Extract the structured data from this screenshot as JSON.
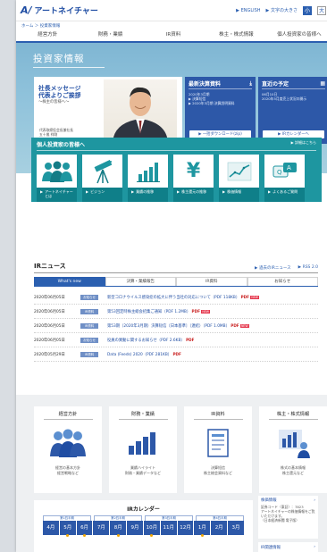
{
  "header": {
    "logo": "アートネイチャー",
    "english": "ENGLISH",
    "fontsize_label": "文字の大きさ",
    "fs_small": "小",
    "fs_large": "大"
  },
  "breadcrumb": "ホーム ＞ 投資家情報",
  "gnav": [
    "経営方針",
    "財務・業績",
    "IR資料",
    "株主・株式情報",
    "個人投資家の皆様へ"
  ],
  "hero": {
    "title": "投資家情報",
    "message_title_1": "社長メッセージ",
    "message_title_2": "代表よりご挨拶",
    "message_sub": "～株主の皆様へ～",
    "message_name_1": "代表取締役会長兼社長",
    "message_name_2": "五十嵐 祥剛",
    "latest_title": "最新決算資料",
    "latest_l1": "2020年3月期",
    "latest_l2": "▶ 決算短信",
    "latest_l3": "▶ 2020年3月期 決算説明資料",
    "latest_btn": "一括ダウンロード(zip)",
    "schedule_title": "直近の予定",
    "schedule_l1": "06月10日",
    "schedule_l2": "2020年5月度売上状況の開示",
    "schedule_btn": "IRカレンダーへ"
  },
  "individual": {
    "title": "個人投資家の皆様へ",
    "more": "▶ 詳細はこちら",
    "tiles": [
      {
        "label": "アートネイチャーとは",
        "icon": "people-icon"
      },
      {
        "label": "ビジョン",
        "icon": "telescope-icon"
      },
      {
        "label": "業績の推移",
        "icon": "bar-chart-icon"
      },
      {
        "label": "株主還元の推移",
        "icon": "yen-icon"
      },
      {
        "label": "株価情報",
        "icon": "line-chart-icon"
      },
      {
        "label": "よくあるご質問",
        "icon": "qa-icon"
      }
    ]
  },
  "ir": {
    "title": "IRニュース",
    "link_list": "▶ 過去のIRニュース",
    "link_rss": "▶ RSS 2.0",
    "tabs": [
      "What's new",
      "決算・業績報告",
      "IR資料",
      "お知らせ"
    ],
    "rows": [
      {
        "date": "2020年06月05日",
        "cat": "お知らせ",
        "text": "新型コロナウイルス感染症の拡大に伴う当社の対応について（PDF 118KB）",
        "pdf": "PDF",
        "new": "NEW"
      },
      {
        "date": "2020年06月05日",
        "cat": "IR資料",
        "text": "第53回定時株主総会招集ご通知（PDF 1.2MB）",
        "pdf": "PDF",
        "new": "NEW"
      },
      {
        "date": "2020年06月05日",
        "cat": "IR資料",
        "text": "第53期（2020年3月期）決算短信〔日本基準〕（連結）（PDF 1.0MB）",
        "pdf": "PDF",
        "new": "NEW"
      },
      {
        "date": "2020年06月05日",
        "cat": "お知らせ",
        "text": "役員の異動に関するお知らせ（PDF 2.6KB）",
        "pdf": "PDF",
        "new": ""
      },
      {
        "date": "2020年05月29日",
        "cat": "IR資料",
        "text": "Data (Feeds) 2020（PDF 281KB）",
        "pdf": "PDF",
        "new": ""
      }
    ]
  },
  "links": [
    {
      "title": "経営方針",
      "desc1": "経営の基本方針",
      "desc2": "経営戦略など"
    },
    {
      "title": "財務・業績",
      "desc1": "業績ハイライト",
      "desc2": "財務・業績データなど"
    },
    {
      "title": "IR資料",
      "desc1": "決算短信",
      "desc2": "株主総会資料など"
    },
    {
      "title": "株主・株式情報",
      "desc1": "株式の基本情報",
      "desc2": "株主還元など"
    }
  ],
  "calendar": {
    "title": "IRカレンダー",
    "quarters": [
      "第1四半期",
      "第2四半期",
      "第3四半期",
      "第4四半期"
    ],
    "months": [
      "4月",
      "5月",
      "6月",
      "7月",
      "8月",
      "9月",
      "10月",
      "11月",
      "12月",
      "1月",
      "2月",
      "3月"
    ]
  },
  "side": {
    "stock_title": "株価情報",
    "stock_l1": "証券コード（東証）：7823",
    "stock_l2": "アートネイチャーの株価情報をご覧いただけます。",
    "stock_l3": "（日本経済新聞 電子版）",
    "disclaimer": "IR関連情報"
  },
  "colors": {
    "brand": "#2b5fb0",
    "teal": "#1e96a0",
    "hero": "#8fc2db"
  }
}
